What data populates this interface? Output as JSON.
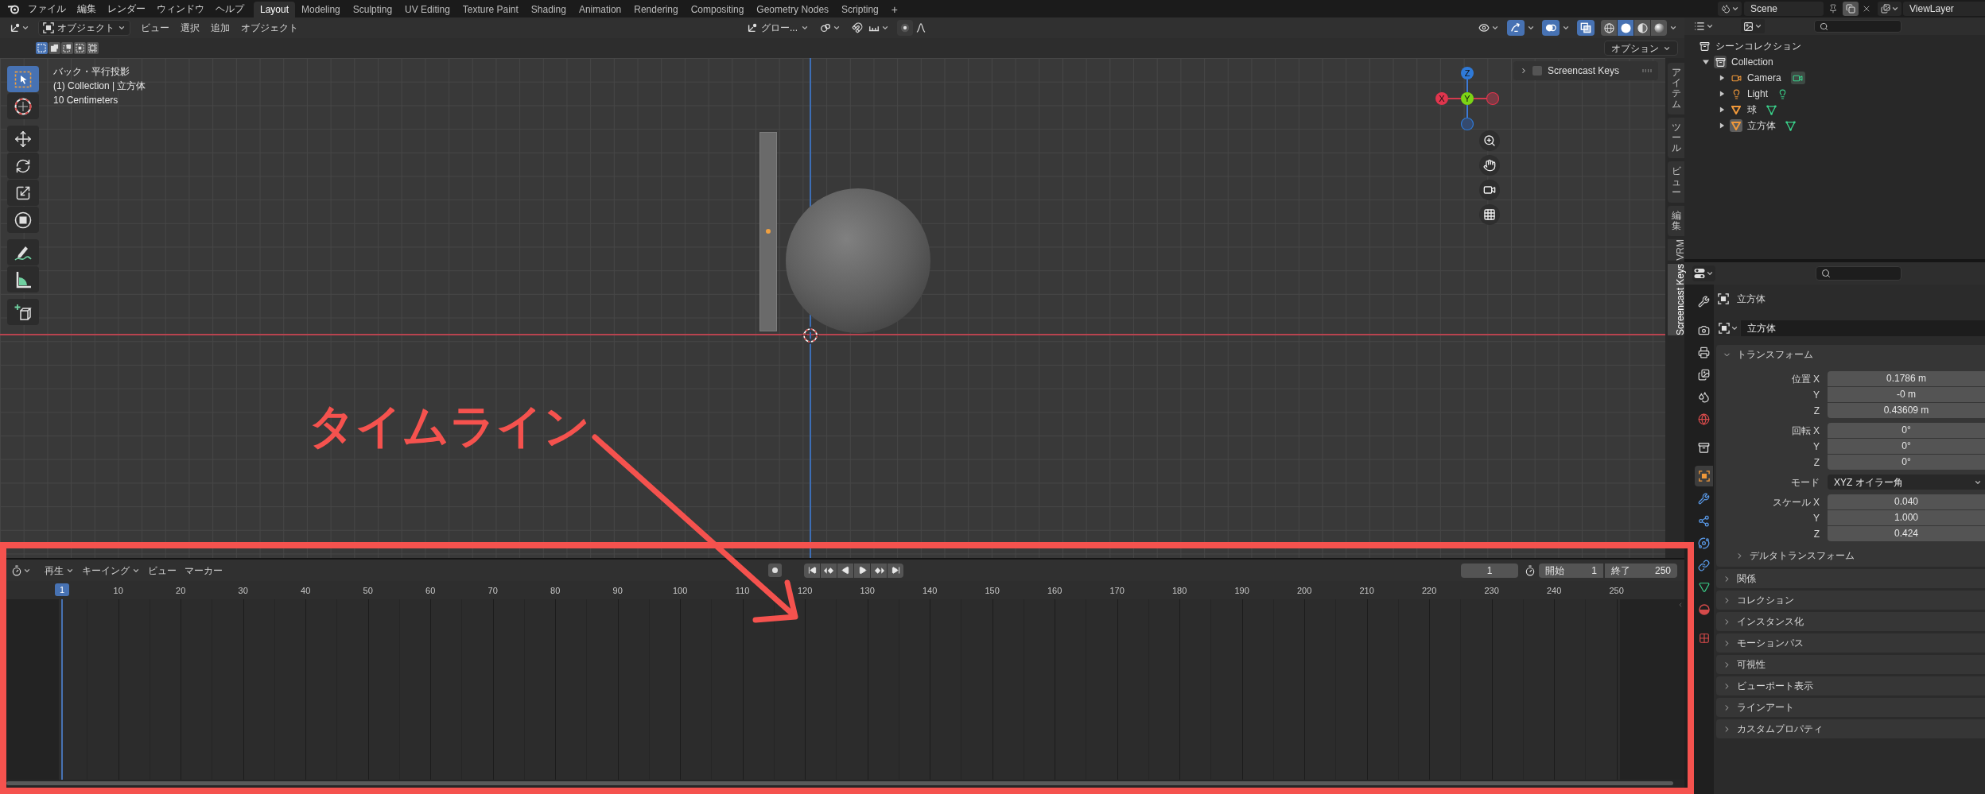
{
  "top_bar": {
    "menus": [
      "ファイル",
      "編集",
      "レンダー",
      "ウィンドウ",
      "ヘルプ"
    ],
    "workspaces": [
      {
        "label": "Layout",
        "selected": true
      },
      {
        "label": "Modeling",
        "selected": false
      },
      {
        "label": "Sculpting",
        "selected": false
      },
      {
        "label": "UV Editing",
        "selected": false
      },
      {
        "label": "Texture Paint",
        "selected": false
      },
      {
        "label": "Shading",
        "selected": false
      },
      {
        "label": "Animation",
        "selected": false
      },
      {
        "label": "Rendering",
        "selected": false
      },
      {
        "label": "Compositing",
        "selected": false
      },
      {
        "label": "Geometry Nodes",
        "selected": false
      },
      {
        "label": "Scripting",
        "selected": false
      }
    ],
    "add_workspace": "+",
    "scene": "Scene",
    "view_layer": "ViewLayer"
  },
  "viewport": {
    "header": {
      "mode": "オブジェクト",
      "menus": [
        "ビュー",
        "選択",
        "追加",
        "オブジェクト"
      ],
      "orientation": "グロー...",
      "toggles": [
        {
          "kind": "gizmos",
          "on": true
        },
        {
          "kind": "overlays",
          "on": true
        },
        {
          "kind": "xray",
          "on": true
        }
      ],
      "shading": [
        {
          "kind": "wireframe",
          "selected": false
        },
        {
          "kind": "solid",
          "selected": true
        },
        {
          "kind": "material",
          "selected": false
        },
        {
          "kind": "rendered",
          "selected": false
        }
      ]
    },
    "select_modes": [
      {
        "kind": "set",
        "selected": true
      },
      {
        "kind": "extend",
        "selected": false
      },
      {
        "kind": "subtract",
        "selected": false
      },
      {
        "kind": "invert",
        "selected": false
      },
      {
        "kind": "intersect",
        "selected": false
      }
    ],
    "options": "オプション",
    "tool_groups": [
      [
        {
          "kind": "select_box",
          "selected": true
        },
        {
          "kind": "cursor",
          "selected": false
        }
      ],
      [
        {
          "kind": "move",
          "selected": false
        },
        {
          "kind": "rotate",
          "selected": false
        },
        {
          "kind": "scale",
          "selected": false
        },
        {
          "kind": "transform",
          "selected": false
        }
      ],
      [
        {
          "kind": "annotate",
          "selected": false
        },
        {
          "kind": "measure",
          "selected": false
        }
      ],
      [
        {
          "kind": "add_cube",
          "selected": false
        }
      ]
    ],
    "info": [
      "バック・平行投影",
      "(1) Collection | 立方体",
      "10 Centimeters"
    ],
    "gizmo": {
      "z": "Z",
      "x": "X",
      "y": "Y"
    },
    "screencast_panel": {
      "label": "Screencast Keys",
      "checked": false,
      "expanded": false
    },
    "sidebar_tabs": [
      {
        "label": "アイテム",
        "selected": false
      },
      {
        "label": "ツール",
        "selected": false
      },
      {
        "label": "ビュー",
        "selected": false
      },
      {
        "label": "編集",
        "selected": false
      },
      {
        "label": "VRM",
        "selected": false
      },
      {
        "label": "Screencast Keys",
        "selected": true
      }
    ]
  },
  "timeline": {
    "menus": [
      {
        "label": "再生",
        "kind": "dropdown"
      },
      {
        "label": "キーイング",
        "kind": "dropdown"
      },
      {
        "label": "ビュー",
        "kind": "menu"
      },
      {
        "label": "マーカー",
        "kind": "menu"
      }
    ],
    "current_frame": "1",
    "start": {
      "label": "開始",
      "value": "1"
    },
    "end": {
      "label": "終了",
      "value": "250"
    },
    "playhead": "1",
    "ruler": [
      "10",
      "20",
      "30",
      "40",
      "50",
      "60",
      "70",
      "80",
      "90",
      "100",
      "110",
      "120",
      "130",
      "140",
      "150",
      "160",
      "170",
      "180",
      "190",
      "200",
      "210",
      "220",
      "230",
      "240",
      "250"
    ]
  },
  "outliner": {
    "tree": [
      {
        "label": "シーンコレクション",
        "kind": "scene_collection",
        "children": [
          {
            "label": "Collection",
            "kind": "collection",
            "expanded": true,
            "children": [
              {
                "label": "Camera",
                "kind": "camera",
                "expanded": false,
                "selected": false
              },
              {
                "label": "Light",
                "kind": "light",
                "expanded": false,
                "selected": false
              },
              {
                "label": "球",
                "kind": "mesh",
                "expanded": false,
                "selected": false
              },
              {
                "label": "立方体",
                "kind": "mesh",
                "expanded": false,
                "selected": true
              }
            ]
          }
        ]
      }
    ]
  },
  "properties": {
    "tab_groups": [
      [
        {
          "kind": "tool",
          "selected": false
        }
      ],
      [
        {
          "kind": "render",
          "selected": false
        },
        {
          "kind": "output",
          "selected": false
        },
        {
          "kind": "view_layer",
          "selected": false
        },
        {
          "kind": "scene",
          "selected": false
        },
        {
          "kind": "world",
          "selected": false
        }
      ],
      [
        {
          "kind": "collection",
          "selected": false
        }
      ],
      [
        {
          "kind": "object",
          "selected": true
        },
        {
          "kind": "modifiers",
          "selected": false
        },
        {
          "kind": "particles",
          "selected": false
        },
        {
          "kind": "physics",
          "selected": false
        },
        {
          "kind": "constraints",
          "selected": false
        },
        {
          "kind": "data",
          "selected": false
        },
        {
          "kind": "material",
          "selected": false
        }
      ],
      [
        {
          "kind": "texture",
          "selected": false
        }
      ]
    ],
    "object_title": "立方体",
    "object_name": "立方体",
    "transform": {
      "title": "トランスフォーム",
      "expanded": true,
      "groups": [
        {
          "kind": "fields",
          "rows": [
            {
              "label": "位置 X",
              "value": "0.1786 m"
            },
            {
              "label": "Y",
              "value": "-0 m"
            },
            {
              "label": "Z",
              "value": "0.43609 m"
            }
          ]
        },
        {
          "kind": "fields",
          "rows": [
            {
              "label": "回転 X",
              "value": "0°"
            },
            {
              "label": "Y",
              "value": "0°"
            },
            {
              "label": "Z",
              "value": "0°"
            }
          ]
        },
        {
          "kind": "dropdown",
          "rows": [
            {
              "label": "モード",
              "value": "XYZ オイラー角"
            }
          ]
        },
        {
          "kind": "fields",
          "rows": [
            {
              "label": "スケール X",
              "value": "0.040"
            },
            {
              "label": "Y",
              "value": "1.000"
            },
            {
              "label": "Z",
              "value": "0.424"
            }
          ]
        }
      ],
      "subpanels": [
        {
          "label": "デルタトランスフォーム",
          "expanded": false
        }
      ]
    },
    "panels": [
      {
        "label": "関係",
        "expanded": false
      },
      {
        "label": "コレクション",
        "expanded": false
      },
      {
        "label": "インスタンス化",
        "expanded": false
      },
      {
        "label": "モーションパス",
        "expanded": false
      },
      {
        "label": "可視性",
        "expanded": false
      },
      {
        "label": "ビューポート表示",
        "expanded": false
      },
      {
        "label": "ラインアート",
        "expanded": false
      },
      {
        "label": "カスタムプロパティ",
        "expanded": false
      }
    ]
  },
  "annotation": {
    "label": "タイムライン"
  }
}
